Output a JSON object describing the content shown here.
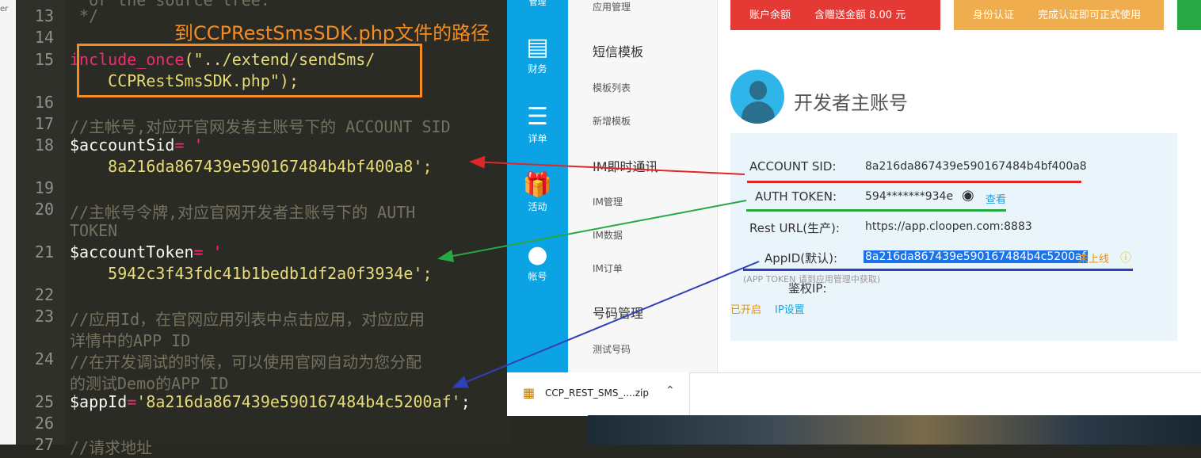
{
  "left_strip_text": "er",
  "editor": {
    "line_numbers": [
      "13",
      "14",
      "15",
      "",
      "16",
      "17",
      "18",
      "",
      "19",
      "20",
      "",
      "21",
      "",
      "22",
      "23",
      "",
      "24",
      "",
      "25",
      "26",
      "27"
    ],
    "lines": {
      "l13": " */",
      "l13b": "  or the source tree.",
      "l15a": "include_once",
      "l15b": "(\"../extend/sendSms/",
      "l15c": "    CCPRestSmsSDK.php\");",
      "l17": "//主帐号,对应开官网发者主账号下的 ACCOUNT SID",
      "l18a": "$accountSid",
      "l18b": "= '",
      "l18c": "    8a216da867439e590167484b4bf400a8",
      "l18d": "';",
      "l20a": "//主帐号令牌,对应官网开发者主账号下的 AUTH",
      "l20b": "TOKEN",
      "l21a": "$accountToken",
      "l21b": "= '",
      "l21c": "    5942c3f43fdc41b1bedb1df2a0f3934e",
      "l21d": "';",
      "l23a": "//应用Id，在官网应用列表中点击应用，对应应用",
      "l23b": "详情中的APP ID",
      "l24a": "//在开发调试的时候，可以使用官网自动为您分配",
      "l24b": "的测试Demo的APP ID",
      "l25a": "$appId",
      "l25b": "=",
      "l25c": "'8a216da867439e590167484b4c5200af'",
      "l25d": ";",
      "l27": "//请求地址"
    },
    "annotation": "到CCPRestSmsSDK.php文件的路径"
  },
  "sidenav": [
    {
      "label": "管理"
    },
    {
      "label": "财务",
      "icon": "finance-icon"
    },
    {
      "label": "详单",
      "icon": "calendar-list-icon"
    },
    {
      "label": "活动",
      "icon": "gift-icon"
    },
    {
      "label": "帐号",
      "icon": "user-icon"
    }
  ],
  "submenu": {
    "app_manage": "应用管理",
    "sms_template": "短信模板",
    "template_list": "模板列表",
    "add_template": "新增模板",
    "im": "IM即时通讯",
    "im_manage": "IM管理",
    "im_data": "IM数据",
    "im_order": "IM订单",
    "number_manage": "号码管理",
    "test_number": "测试号码"
  },
  "topbar": {
    "balance_label": "账户余额",
    "gift_label": "含赠送金额 8.00 元",
    "identity_label": "身份认证",
    "identity_note": "完成认证即可正式使用"
  },
  "account": {
    "title": "开发者主账号",
    "sid_label": "ACCOUNT SID:",
    "sid_value": "8a216da867439e590167484b4bf400a8",
    "token_label": "AUTH TOKEN:",
    "token_value": "594*******934e",
    "token_view": "查看",
    "rest_label": "Rest URL(生产):",
    "rest_value": "https://app.cloopen.com:8883",
    "appid_label": "AppID(默认):",
    "appid_value": "8a216da867439e590167484b4c5200af",
    "appid_status": "未上线",
    "appid_note": "(APP TOKEN 请到应用管理中获取)",
    "auth_ip_label": "鉴权IP:",
    "enabled": "已开启",
    "ip_settings": "IP设置"
  },
  "download": {
    "filename": "CCP_REST_SMS_....zip"
  },
  "colors": {
    "sid_line": "#e0262b",
    "token_line": "#27a845",
    "appid_line": "#3040b8",
    "annotation": "#f68b1f"
  }
}
